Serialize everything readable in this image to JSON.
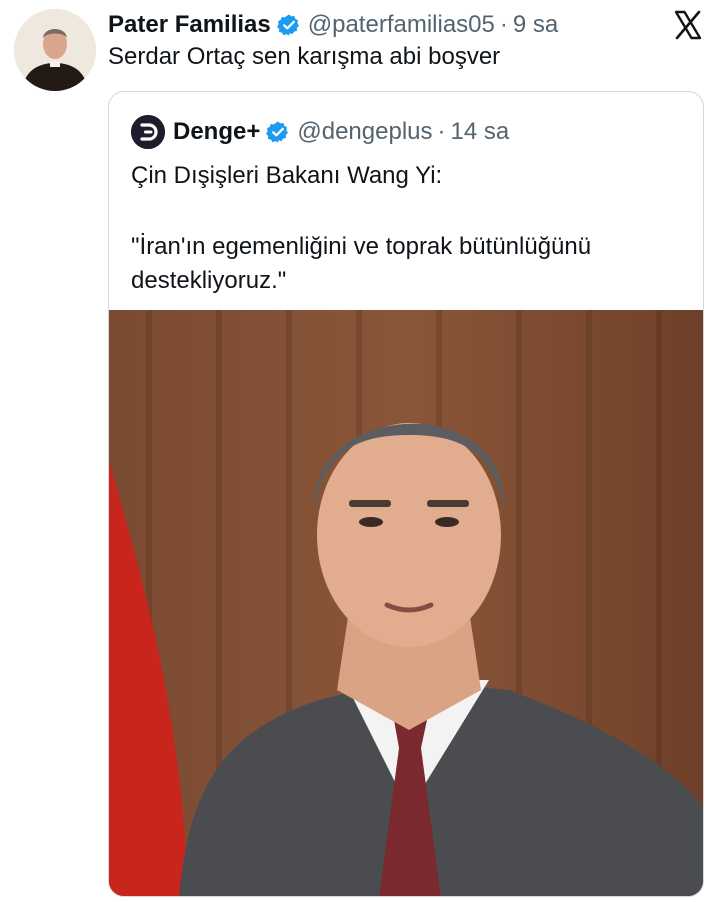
{
  "tweet": {
    "author_name": "Pater Familias",
    "author_handle": "@paterfamilias05",
    "time": "9 sa",
    "separator": "·",
    "text": "Serdar Ortaç sen karışma abi boşver"
  },
  "quote": {
    "author_name": "Denge+",
    "author_handle": "@dengeplus",
    "separator": "·",
    "time": "14 sa",
    "line1": "Çin Dışişleri Bakanı Wang Yi:",
    "line2": "\"İran'ın egemenliğini ve toprak bütünlüğünü destekliyoruz.\""
  },
  "icons": {
    "verified": "verified-badge-icon",
    "platform": "x-logo-icon",
    "quote_logo": "denge-logo-icon"
  },
  "colors": {
    "verified_blue": "#1d9bf0",
    "secondary_text": "#536471",
    "border": "#cfd9de"
  }
}
